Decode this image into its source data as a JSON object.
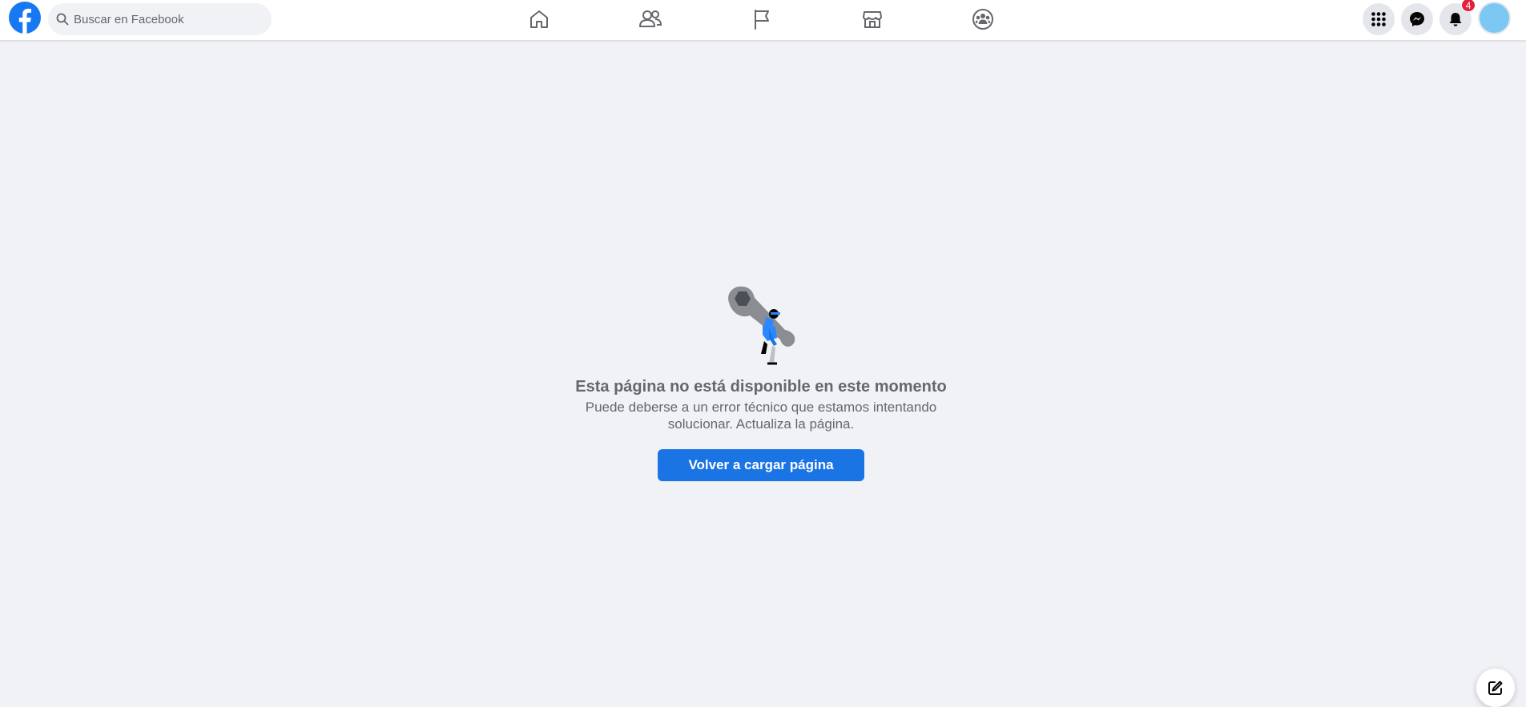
{
  "header": {
    "logo": "facebook-logo",
    "search": {
      "placeholder": "Buscar en Facebook",
      "value": ""
    },
    "nav_icons": [
      "home-icon",
      "friends-icon",
      "pages-flag-icon",
      "marketplace-icon",
      "groups-icon"
    ],
    "right_icons": [
      "menu-grid-icon",
      "messenger-icon",
      "notifications-bell-icon"
    ],
    "notifications_count": "4",
    "accent_color": "#1b74e4"
  },
  "error": {
    "title": "Esta página no está disponible en este momento",
    "description": "Puede deberse a un error técnico que estamos intentando solucionar. Actualiza la página.",
    "button_label": "Volver a cargar página",
    "illustration": "wrench-character-illustration"
  },
  "footer": {
    "compose_icon": "compose-message-icon"
  }
}
